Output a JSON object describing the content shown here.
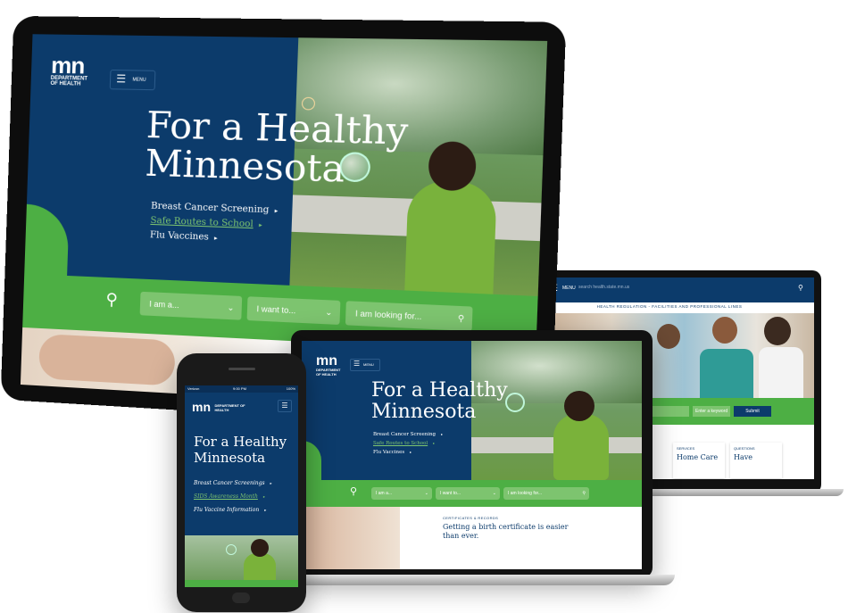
{
  "brand": {
    "logo_mark": "mn",
    "org_line1": "DEPARTMENT",
    "org_line2": "OF HEALTH",
    "org_full": "DEPARTMENT OF HEALTH",
    "colors": {
      "navy": "#0c3b6b",
      "green": "#4daf44",
      "light_green": "#7dc46f"
    }
  },
  "nav": {
    "menu_label": "MENU",
    "menu_icon": "hamburger-icon"
  },
  "hero": {
    "title_line1": "For a Healthy",
    "title_line2": "Minnesota"
  },
  "desktop_links": [
    {
      "label": "Breast Cancer Screening",
      "active": false
    },
    {
      "label": "Safe Routes to School",
      "active": true
    },
    {
      "label": "Flu Vaccines",
      "active": false
    }
  ],
  "phone_links": [
    {
      "label": "Breast Cancer Screenings",
      "active": false
    },
    {
      "label": "SIDS Awareness Month",
      "active": true
    },
    {
      "label": "Flu Vaccine Information",
      "active": false
    }
  ],
  "search_bar": {
    "i_am": "I am a...",
    "i_want": "I want to...",
    "looking_for": "I am looking for..."
  },
  "phone_status": {
    "carrier": "Verizon",
    "time": "9:00 PM",
    "battery": "100%"
  },
  "laptop_story": {
    "label": "CERTIFICATES & RECORDS",
    "headline": "Getting a birth certificate is easier than ever."
  },
  "secondary": {
    "search_placeholder": "search health.state.mn.us",
    "banner": "HEALTH REGULATION - FACILITIES AND PROFESSIONAL LINES",
    "field1": "I am a...",
    "field2": "Enter a keyword",
    "submit": "Submit",
    "card1_label": "SERVICES",
    "card1_title": "Home Care",
    "card2_label": "QUESTIONS",
    "card2_title": "Have"
  }
}
